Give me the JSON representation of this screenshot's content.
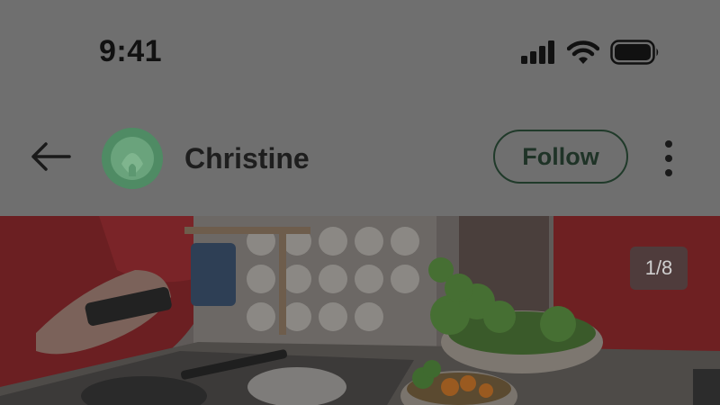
{
  "status_bar": {
    "time": "9:41",
    "icons": [
      "cellular-signal-icon",
      "wifi-icon",
      "battery-icon"
    ]
  },
  "header": {
    "back_icon": "arrow-left-icon",
    "avatar_icon": "profile-avatar",
    "username": "Christine",
    "follow_label": "Follow",
    "more_icon": "more-vertical-icon"
  },
  "post": {
    "image_description_icon": "post-photo",
    "page_indicator": "1/8"
  },
  "colors": {
    "overlay": "#6f6f6f",
    "avatar_green": "#4d8a63",
    "follow_border": "#203a2a"
  }
}
